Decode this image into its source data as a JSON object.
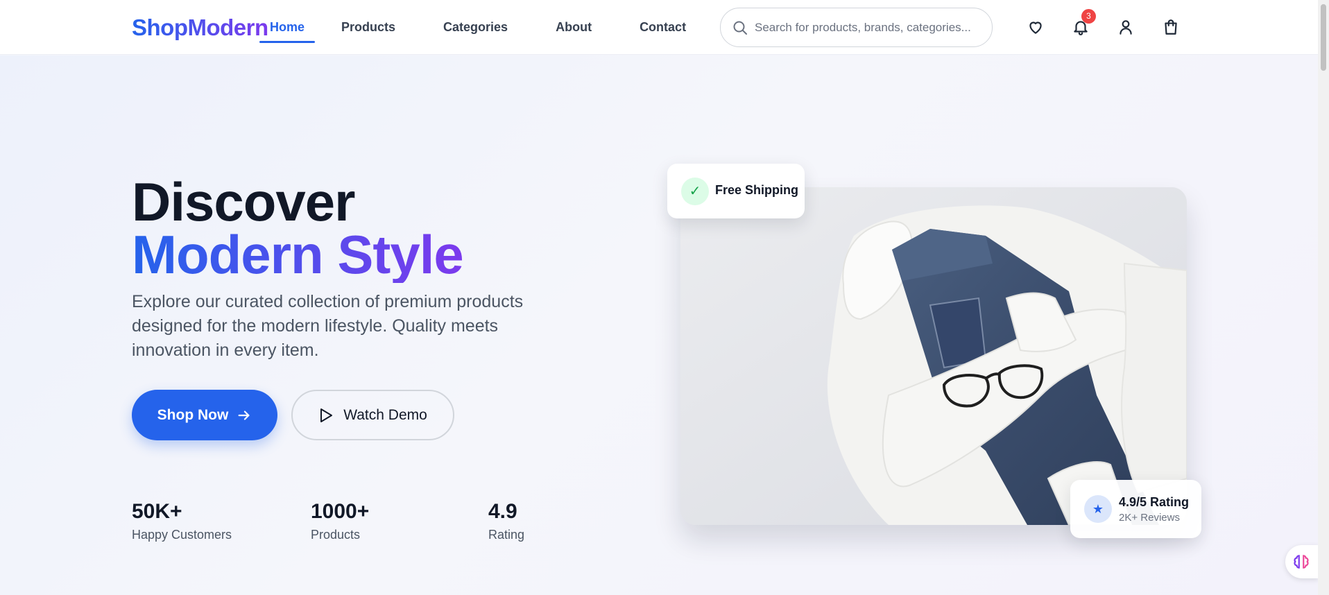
{
  "brand": {
    "name": "ShopModern"
  },
  "nav": {
    "items": [
      {
        "label": "Home",
        "active": true
      },
      {
        "label": "Products",
        "active": false
      },
      {
        "label": "Categories",
        "active": false
      },
      {
        "label": "About",
        "active": false
      },
      {
        "label": "Contact",
        "active": false
      }
    ]
  },
  "search": {
    "placeholder": "Search for products, brands, categories..."
  },
  "header_icons": {
    "wishlist": "heart-icon",
    "notifications": "bell-icon",
    "notification_count": "3",
    "account": "user-icon",
    "cart": "shopping-bag-icon"
  },
  "hero": {
    "title_line1": "Discover",
    "title_line2": "Modern Style",
    "description": "Explore our curated collection of premium products designed for the modern lifestyle. Quality meets innovation in every item.",
    "primary_cta": "Shop Now",
    "secondary_cta": "Watch Demo",
    "stats": [
      {
        "value": "50K+",
        "label": "Happy Customers"
      },
      {
        "value": "1000+",
        "label": "Products"
      },
      {
        "value": "4.9",
        "label": "Rating"
      }
    ]
  },
  "badges": {
    "shipping": "Free Shipping",
    "rating_title": "4.9/5 Rating",
    "rating_sub": "2K+ Reviews"
  },
  "colors": {
    "accent": "#2563eb",
    "accent_secondary": "#7c3aed",
    "notification": "#ef4444",
    "success": "#16a34a"
  }
}
